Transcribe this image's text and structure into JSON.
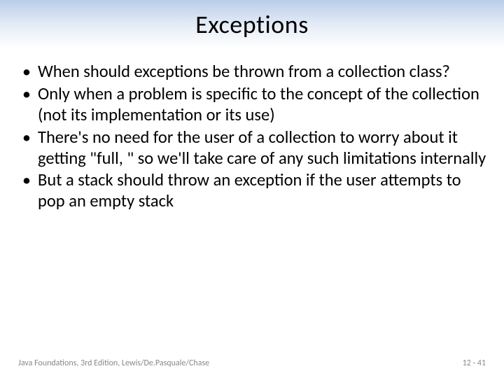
{
  "title": "Exceptions",
  "bullets": [
    "When should exceptions be thrown from a collection class?",
    "Only when a problem is specific to the concept of the collection (not its implementation or its use)",
    "There's no need for the user of a collection to worry about it getting \"full, \" so we'll take care of any such limitations internally",
    "But a stack should throw an exception if the user attempts to pop an empty stack"
  ],
  "footer": {
    "left": "Java Foundations, 3rd Edition, Lewis/De.Pasquale/Chase",
    "right": "12 - 41"
  }
}
